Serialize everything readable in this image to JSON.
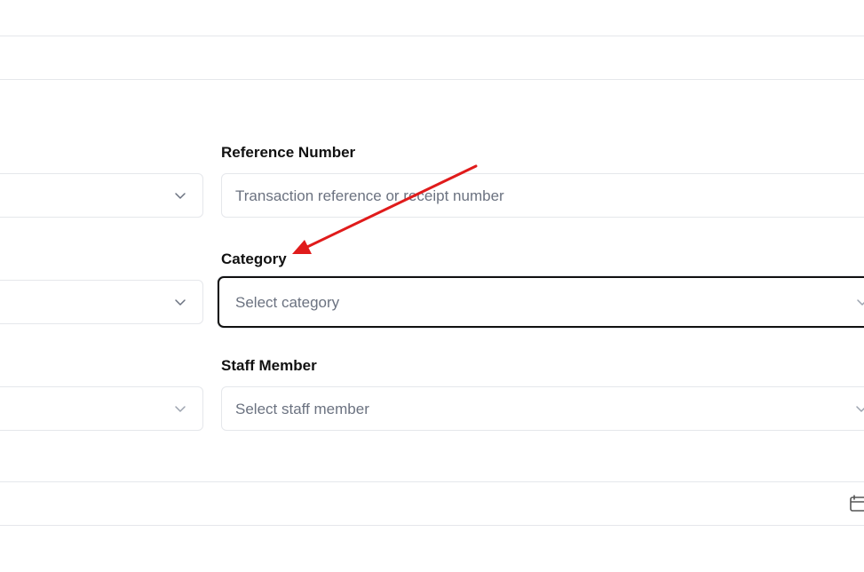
{
  "form": {
    "reference_number": {
      "label": "Reference Number",
      "placeholder": "Transaction reference or receipt number",
      "value": ""
    },
    "category": {
      "label": "Category",
      "placeholder": "Select category"
    },
    "staff_member": {
      "label": "Staff Member",
      "placeholder": "Select staff member"
    }
  },
  "icons": {
    "select_chevron": "chevron-down-icon",
    "date_picker": "calendar-icon",
    "annotation": "red-arrow"
  },
  "colors": {
    "border": "#e5e7eb",
    "focus_border": "#111111",
    "placeholder": "#6b7280",
    "annotation_arrow": "#e01b1b"
  }
}
